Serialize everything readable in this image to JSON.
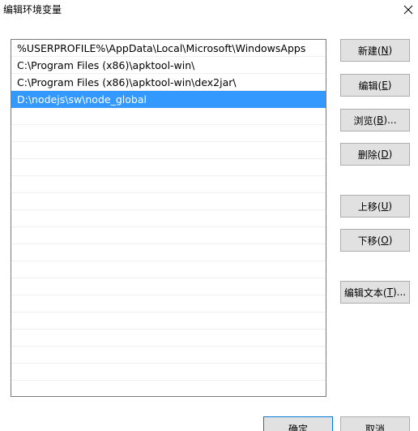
{
  "window": {
    "title": "编辑环境变量"
  },
  "path_list": {
    "items": [
      "%USERPROFILE%\\AppData\\Local\\Microsoft\\WindowsApps",
      "C:\\Program Files (x86)\\apktool-win\\",
      "C:\\Program Files (x86)\\apktool-win\\dex2jar\\",
      "D:\\nodejs\\sw\\node_global"
    ],
    "selected_index": 3,
    "selection_color": "#3399ff"
  },
  "buttons": {
    "new": {
      "label": "新建(",
      "mnemonic": "N",
      "suffix": ")"
    },
    "edit": {
      "label": "编辑(",
      "mnemonic": "E",
      "suffix": ")"
    },
    "browse": {
      "label": "浏览(",
      "mnemonic": "B",
      "suffix": ")..."
    },
    "delete": {
      "label": "删除(",
      "mnemonic": "D",
      "suffix": ")"
    },
    "move_up": {
      "label": "上移(",
      "mnemonic": "U",
      "suffix": ")"
    },
    "move_down": {
      "label": "下移(",
      "mnemonic": "O",
      "suffix": ")"
    },
    "edit_text": {
      "label": "编辑文本(",
      "mnemonic": "T",
      "suffix": ")..."
    }
  },
  "footer": {
    "ok_label": "确定",
    "cancel_label": "取消"
  },
  "icons": {
    "close": "close-icon"
  }
}
